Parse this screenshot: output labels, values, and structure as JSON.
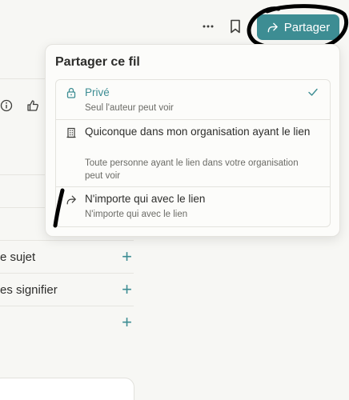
{
  "header": {
    "more_icon": "more-dots-icon",
    "bookmark_icon": "bookmark-icon",
    "share_button_label": "Partager",
    "share_icon": "share-arrow-icon"
  },
  "background": {
    "reaction_icons": [
      "info-icon",
      "thumbs-up-icon"
    ],
    "topic_rows": [
      {
        "label": "e sujet",
        "action": "+"
      },
      {
        "label": "es signifier",
        "action": "+"
      },
      {
        "label": "",
        "action": "+"
      }
    ]
  },
  "share_menu": {
    "title": "Partager ce fil",
    "options": [
      {
        "label": "Privé",
        "description": "Seul l'auteur peut voir",
        "icon": "lock-icon",
        "selected": true
      },
      {
        "label": "Quiconque dans mon organisation ayant le lien",
        "description": "Toute personne ayant le lien dans votre organisation peut voir",
        "icon": "building-icon",
        "selected": false
      },
      {
        "label": "N'importe qui avec le lien",
        "description": "N'importe qui avec le lien",
        "icon": "share-arrow-icon",
        "selected": false
      }
    ]
  },
  "colors": {
    "accent": "#3d8d93",
    "background": "#f7f7f4",
    "annotation": "#000000"
  }
}
